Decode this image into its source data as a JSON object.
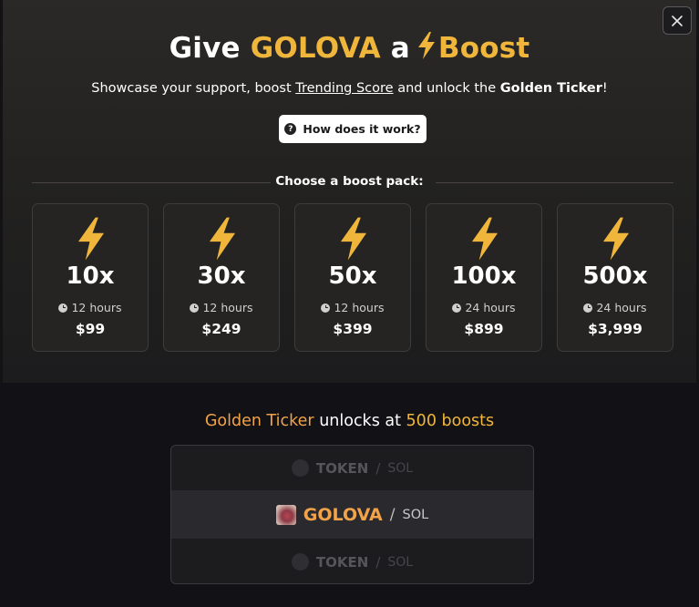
{
  "header": {
    "title_prefix": "Give",
    "token_name": "GOLOVA",
    "title_middle": "a",
    "title_suffix": "Boost",
    "bolt_icon": "lightning-bolt-icon",
    "accent_color": "#f0b63c"
  },
  "subtitle": {
    "part1": "Showcase your support, boost",
    "link": "Trending Score",
    "part2": "and unlock the",
    "bold": "Golden Ticker",
    "part3": "!"
  },
  "how_button": {
    "label": "How does it work?",
    "icon": "question-circle-icon"
  },
  "choose_label": "Choose a boost pack:",
  "packs": [
    {
      "multiplier": "10x",
      "duration": "12 hours",
      "price": "$99"
    },
    {
      "multiplier": "30x",
      "duration": "12 hours",
      "price": "$249"
    },
    {
      "multiplier": "50x",
      "duration": "12 hours",
      "price": "$399"
    },
    {
      "multiplier": "100x",
      "duration": "24 hours",
      "price": "$899"
    },
    {
      "multiplier": "500x",
      "duration": "24 hours",
      "price": "$3,999"
    }
  ],
  "golden": {
    "highlight": "Golden Ticker",
    "middle": "unlocks at",
    "count": "500 boosts",
    "highlight_color": "#f2a349"
  },
  "ticker_rows": [
    {
      "name": "TOKEN",
      "separator": "/",
      "pair": "SOL",
      "state": "faded"
    },
    {
      "name": "GOLOVA",
      "separator": "/",
      "pair": "SOL",
      "state": "active"
    },
    {
      "name": "TOKEN",
      "separator": "/",
      "pair": "SOL",
      "state": "faded"
    }
  ],
  "close_icon": "close-icon"
}
